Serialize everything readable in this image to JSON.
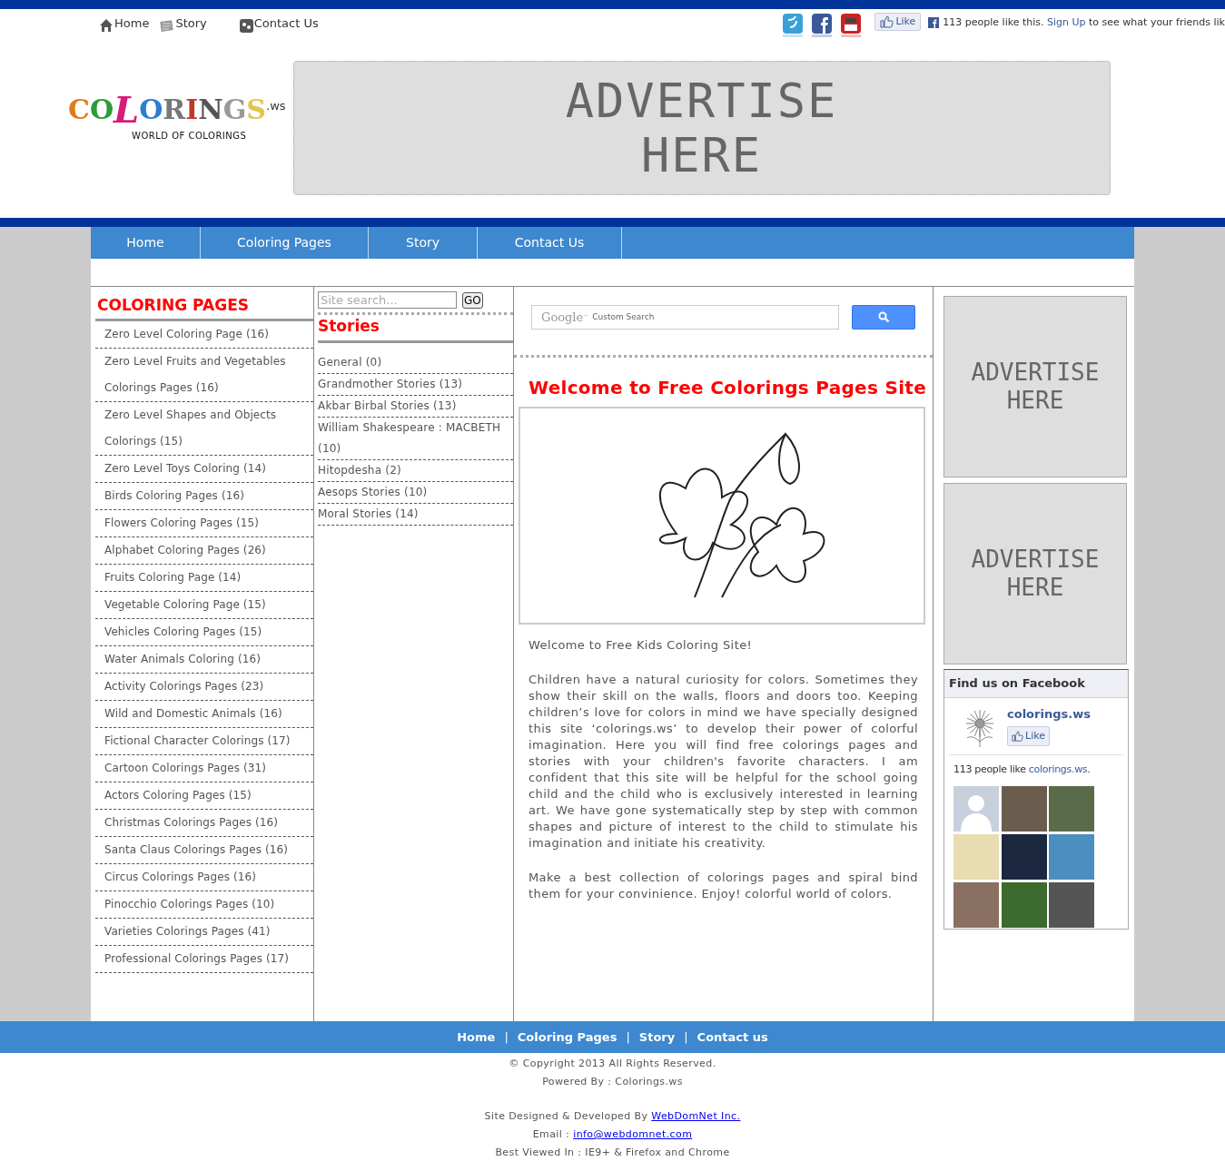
{
  "top_links": [
    {
      "label": "Home"
    },
    {
      "label": "Story"
    },
    {
      "label": "Contact Us"
    }
  ],
  "social": {
    "like_button": "Like",
    "like_text": "113 people like this.",
    "signup_link": "Sign Up",
    "signup_rest": "to see what your friends lik"
  },
  "logo": {
    "text": "COLORINGS",
    "suffix": ".ws",
    "tagline": "WORLD OF COLORINGS"
  },
  "header_ad": {
    "lines": [
      "ADVERTISE",
      "HERE"
    ]
  },
  "nav": [
    "Home",
    "Coloring Pages",
    "Story",
    "Contact Us"
  ],
  "categories": {
    "title": "COLORING PAGES",
    "items": [
      "Zero Level Coloring Page (16)",
      "Zero Level Fruits and Vegetables Colorings Pages (16)",
      "Zero Level Shapes and Objects Colorings (15)",
      "Zero Level Toys Coloring (14)",
      "Birds Coloring Pages (16)",
      "Flowers Coloring Pages (15)",
      "Alphabet Coloring Pages (26)",
      "Fruits Coloring Page (14)",
      "Vegetable Coloring Page (15)",
      "Vehicles Coloring Pages (15)",
      "Water Animals Coloring (16)",
      "Activity Colorings Pages (23)",
      "Wild and Domestic Animals (16)",
      "Fictional Character Colorings (17)",
      "Cartoon Colorings Pages (31)",
      "Actors Coloring Pages (15)",
      "Christmas Colorings Pages (16)",
      "Santa Claus Colorings Pages (16)",
      "Circus Colorings Pages (16)",
      "Pinocchio Colorings Pages (10)",
      "Varieties Colorings Pages (41)",
      "Professional Colorings Pages (17)"
    ]
  },
  "search": {
    "placeholder": "Site search...",
    "button": "GO"
  },
  "stories": {
    "title": "Stories",
    "items": [
      "General (0)",
      "Grandmother Stories (13)",
      "Akbar Birbal Stories (13)",
      "William Shakespeare : MACBETH (10)",
      "Hitopdesha (2)",
      "Aesops Stories (10)",
      "Moral Stories (14)"
    ]
  },
  "google_search": {
    "brand": "Google",
    "tm": "™",
    "label": "Custom Search"
  },
  "welcome": {
    "title": "Welcome to Free Colorings Pages Site",
    "paragraphs": [
      "Welcome to Free Kids Coloring Site!",
      "Children have a natural curiosity for colors. Sometimes they show their skill on the walls, floors and doors too. Keeping children’s love for colors in mind we have specially designed this site ‘colorings.ws’ to develop their power of colorful imagination. Here you will find free colorings pages and stories with your children's favorite characters. I am confident that this site will be helpful for the school going child and the child who is exclusively interested in learning art. We have gone systematically step by step with common shapes and picture of interest to the child to stimulate his imagination and initiate his creativity.",
      "Make a best collection of colorings pages and spiral bind them for your convinience. Enjoy! colorful world of colors."
    ]
  },
  "side_ads": [
    {
      "lines": [
        "ADVERTISE",
        "HERE"
      ]
    },
    {
      "lines": [
        "ADVERTISE",
        "HERE"
      ]
    }
  ],
  "facebook": {
    "title": "Find us on Facebook",
    "page_name": "colorings.ws",
    "like_button": "Like",
    "count_text": "113 people like",
    "count_link": "colorings.ws",
    "count_end": "."
  },
  "footer": {
    "links": [
      "Home",
      "Coloring Pages",
      "Story",
      "Contact us"
    ],
    "separators": [
      "|",
      "|",
      "|"
    ],
    "copyright": "© Copyright 2013 All Rights Reserved.",
    "powered": "Powered By : Colorings.ws",
    "designed": "Site Designed & Developed By",
    "designed_link": "WebDomNet Inc.",
    "email": "Email :",
    "email_link": "info@webdomnet.com",
    "best_viewed": "Best Viewed In : IE9+ & Firefox and Chrome"
  }
}
